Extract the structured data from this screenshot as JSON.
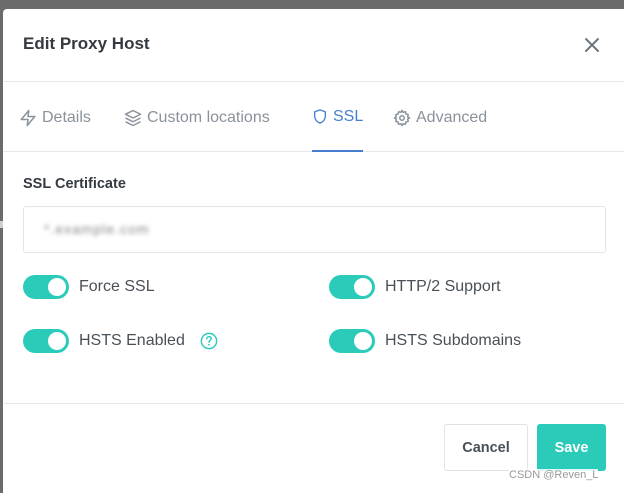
{
  "modal": {
    "title": "Edit Proxy Host"
  },
  "tabs": [
    {
      "label": "Details",
      "icon": "bolt-icon"
    },
    {
      "label": "Custom locations",
      "icon": "layers-icon"
    },
    {
      "label": "SSL",
      "icon": "shield-icon",
      "active": true
    },
    {
      "label": "Advanced",
      "icon": "gear-icon"
    }
  ],
  "ssl": {
    "certificate_label": "SSL Certificate",
    "certificate_value": "*.example.com"
  },
  "toggles": [
    {
      "label": "Force SSL",
      "on": true
    },
    {
      "label": "HTTP/2 Support",
      "on": true
    },
    {
      "label": "HSTS Enabled",
      "on": true
    },
    {
      "label": "HSTS Subdomains",
      "on": true
    }
  ],
  "footer": {
    "cancel_label": "Cancel",
    "save_label": "Save"
  },
  "watermark": "CSDN @Reven_L",
  "colors": {
    "accent": "#2bcbba",
    "active_tab": "#467fcf"
  }
}
